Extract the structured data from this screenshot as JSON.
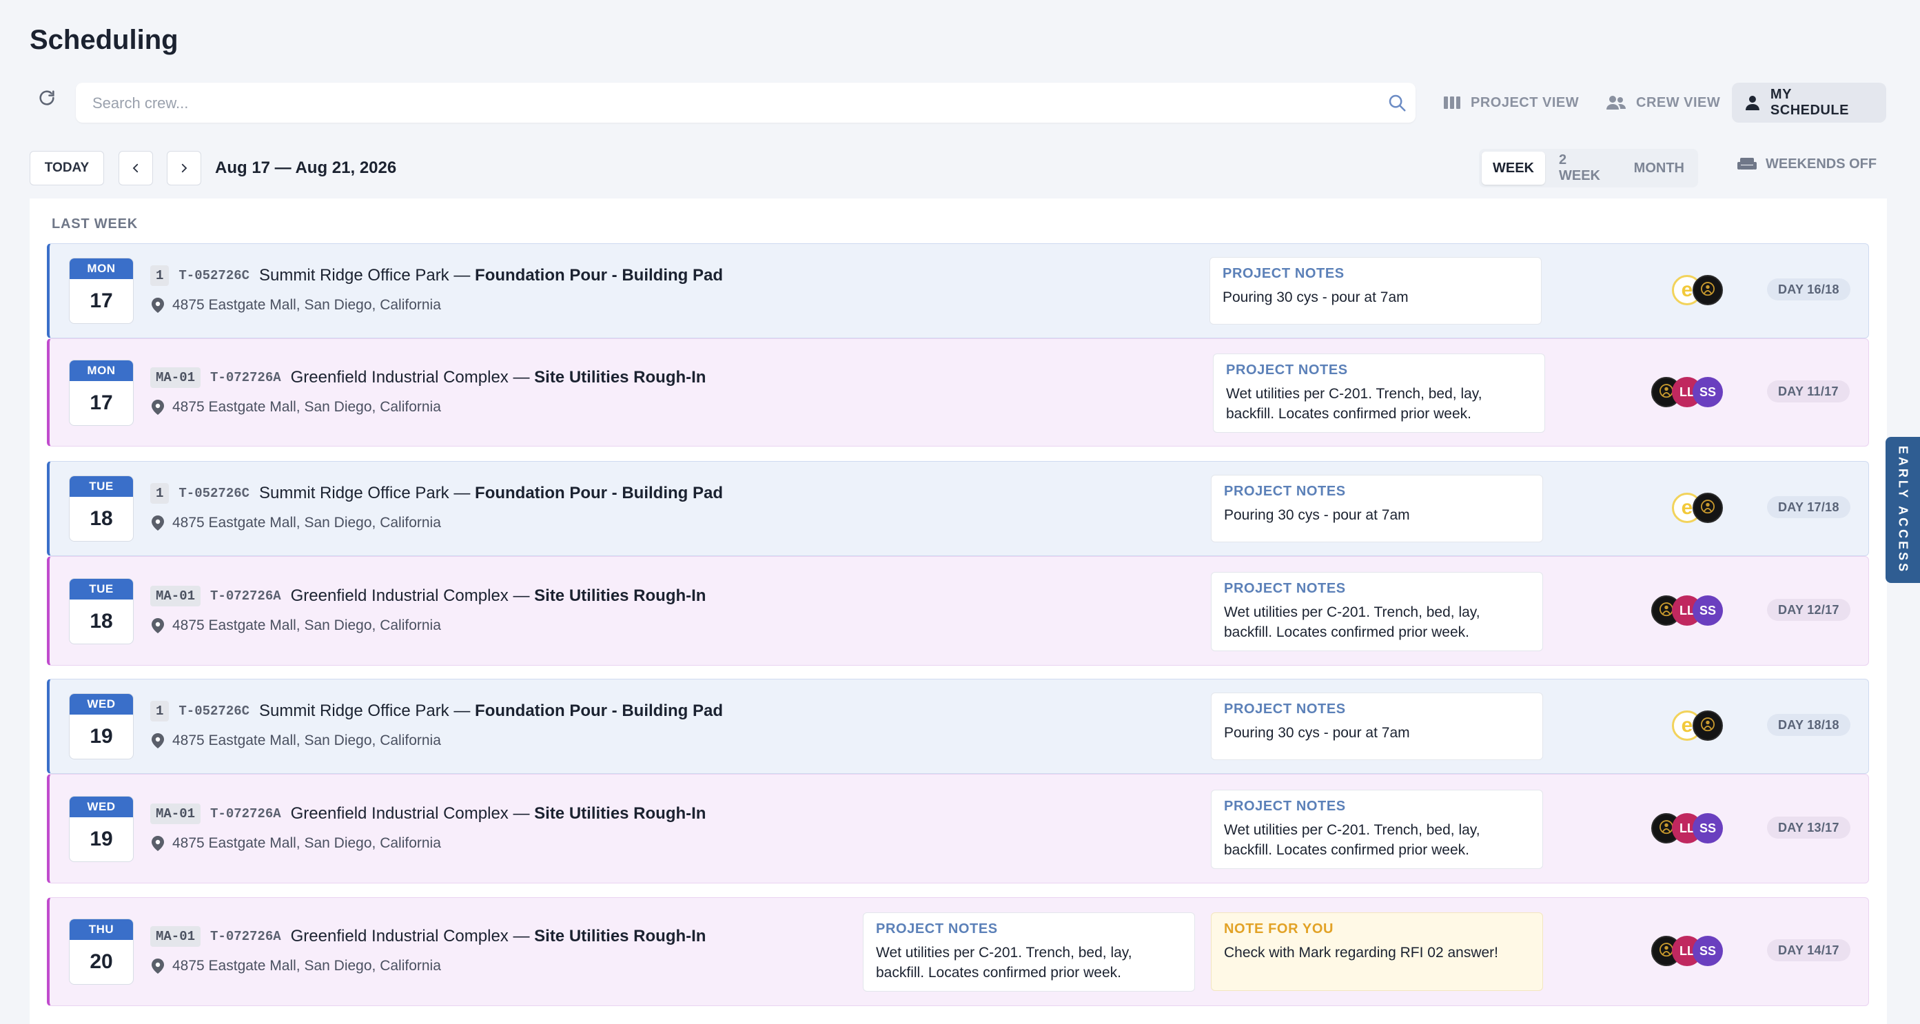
{
  "page": {
    "title": "Scheduling"
  },
  "toolbar": {
    "search_placeholder": "Search crew...",
    "views": [
      {
        "label": "PROJECT VIEW",
        "icon": "columns-icon"
      },
      {
        "label": "CREW VIEW",
        "icon": "people-icon"
      },
      {
        "label": "MY SCHEDULE",
        "icon": "person-icon",
        "active": true
      }
    ]
  },
  "datebar": {
    "today_label": "TODAY",
    "range": "Aug 17 — Aug 21, 2026",
    "ranges": [
      "WEEK",
      "2 WEEK",
      "MONTH"
    ],
    "active_range": "WEEK",
    "weekends_label": "WEEKENDS OFF"
  },
  "section": {
    "label": "LAST WEEK"
  },
  "rows": [
    {
      "dow": "MON",
      "day": "17",
      "tag": "1",
      "code": "T-052726C",
      "project": "Summit Ridge Office Park",
      "sep": " — ",
      "task": "Foundation Pour - Building Pad",
      "address": "4875 Eastgate Mall, San Diego, California",
      "note_label": "PROJECT NOTES",
      "note": "Pouring 30 cys - pour at 7am",
      "day_label": "DAY 16/18",
      "avatars": [
        "e",
        "dark"
      ]
    },
    {
      "dow": "MON",
      "day": "17",
      "tag": "MA-01",
      "code": "T-072726A",
      "project": "Greenfield Industrial Complex",
      "sep": " — ",
      "task": "Site Utilities Rough-In",
      "address": "4875 Eastgate Mall, San Diego, California",
      "note_label": "PROJECT NOTES",
      "note": "Wet utilities per C-201. Trench, bed, lay, backfill. Locates confirmed prior week.",
      "day_label": "DAY 11/17",
      "avatars": [
        "dark",
        "LL",
        "SS"
      ]
    },
    {
      "dow": "TUE",
      "day": "18",
      "tag": "1",
      "code": "T-052726C",
      "project": "Summit Ridge Office Park",
      "sep": " — ",
      "task": "Foundation Pour - Building Pad",
      "address": "4875 Eastgate Mall, San Diego, California",
      "note_label": "PROJECT NOTES",
      "note": "Pouring 30 cys - pour at 7am",
      "day_label": "DAY 17/18",
      "avatars": [
        "e",
        "dark"
      ]
    },
    {
      "dow": "TUE",
      "day": "18",
      "tag": "MA-01",
      "code": "T-072726A",
      "project": "Greenfield Industrial Complex",
      "sep": " — ",
      "task": "Site Utilities Rough-In",
      "address": "4875 Eastgate Mall, San Diego, California",
      "note_label": "PROJECT NOTES",
      "note": "Wet utilities per C-201. Trench, bed, lay, backfill. Locates confirmed prior week.",
      "day_label": "DAY 12/17",
      "avatars": [
        "dark",
        "LL",
        "SS"
      ]
    },
    {
      "dow": "WED",
      "day": "19",
      "tag": "1",
      "code": "T-052726C",
      "project": "Summit Ridge Office Park",
      "sep": " — ",
      "task": "Foundation Pour - Building Pad",
      "address": "4875 Eastgate Mall, San Diego, California",
      "note_label": "PROJECT NOTES",
      "note": "Pouring 30 cys - pour at 7am",
      "day_label": "DAY 18/18",
      "avatars": [
        "e",
        "dark"
      ]
    },
    {
      "dow": "WED",
      "day": "19",
      "tag": "MA-01",
      "code": "T-072726A",
      "project": "Greenfield Industrial Complex",
      "sep": " — ",
      "task": "Site Utilities Rough-In",
      "address": "4875 Eastgate Mall, San Diego, California",
      "note_label": "PROJECT NOTES",
      "note": "Wet utilities per C-201. Trench, bed, lay, backfill. Locates confirmed prior week.",
      "day_label": "DAY 13/17",
      "avatars": [
        "dark",
        "LL",
        "SS"
      ]
    },
    {
      "dow": "THU",
      "day": "20",
      "tag": "MA-01",
      "code": "T-072726A",
      "project": "Greenfield Industrial Complex",
      "sep": " — ",
      "task": "Site Utilities Rough-In",
      "address": "4875 Eastgate Mall, San Diego, California",
      "note_label": "PROJECT NOTES",
      "note": "Wet utilities per C-201. Trench, bed, lay, backfill. Locates confirmed prior week.",
      "note2_label": "NOTE FOR YOU",
      "note2": "Check with Mark regarding RFI 02 answer!",
      "day_label": "DAY 14/17",
      "avatars": [
        "dark",
        "LL",
        "SS"
      ]
    }
  ],
  "early_access": {
    "label": "EARLY ACCESS"
  }
}
